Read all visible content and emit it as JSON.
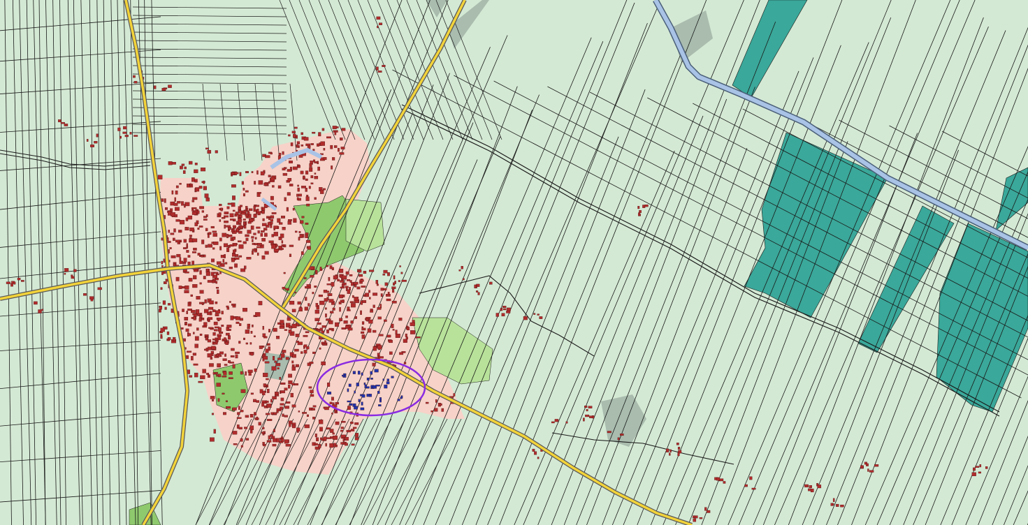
{
  "map": {
    "colors": {
      "meadow": "#d4e9d4",
      "parcel_line": "#1a1a1a",
      "urban_area": "#f7d2c8",
      "building": "#b02c2c",
      "building_outline": "#3a0a0a",
      "main_road": "#f2d33a",
      "main_road_casing": "#5a5a5a",
      "canal": "#a9c3e6",
      "canal_casing": "#4a5f78",
      "greenhouse": "#3aa89a",
      "park": "#8fc96e",
      "sports_field": "#b8e29a",
      "industrial": "#a9bcae",
      "highlight_ellipse": "#8a2be2",
      "highlight_buildings": "#2233aa"
    }
  }
}
